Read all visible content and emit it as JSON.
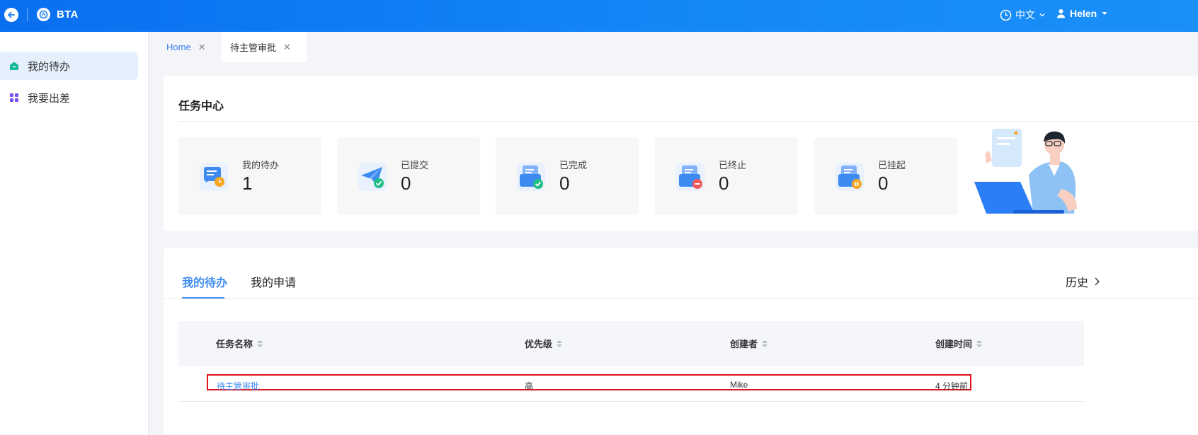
{
  "app": {
    "name": "BTA"
  },
  "header": {
    "language": "中文",
    "user": "Helen"
  },
  "sidebar": {
    "items": [
      {
        "label": "我的待办",
        "icon": "home-icon",
        "active": true
      },
      {
        "label": "我要出差",
        "icon": "apps-grid-icon",
        "active": false
      }
    ]
  },
  "tabs": [
    {
      "label": "Home"
    },
    {
      "label": "待主管审批"
    }
  ],
  "task_center": {
    "title": "任务中心",
    "stats": [
      {
        "label": "我的待办",
        "value": "1"
      },
      {
        "label": "已提交",
        "value": "0"
      },
      {
        "label": "已完成",
        "value": "0"
      },
      {
        "label": "已终止",
        "value": "0"
      },
      {
        "label": "已挂起",
        "value": "0"
      }
    ]
  },
  "list": {
    "tabs": [
      {
        "label": "我的待办"
      },
      {
        "label": "我的申请"
      }
    ],
    "history": "历史",
    "columns": [
      "任务名称",
      "优先级",
      "创建者",
      "创建时间"
    ],
    "rows": [
      {
        "name": "待主管审批",
        "priority": "高",
        "creator": "Mike",
        "time": "4 分钟前"
      }
    ]
  },
  "colors": {
    "primary": "#1588f7",
    "accent": "#3d8bf0",
    "highlight": "#e0121c"
  }
}
